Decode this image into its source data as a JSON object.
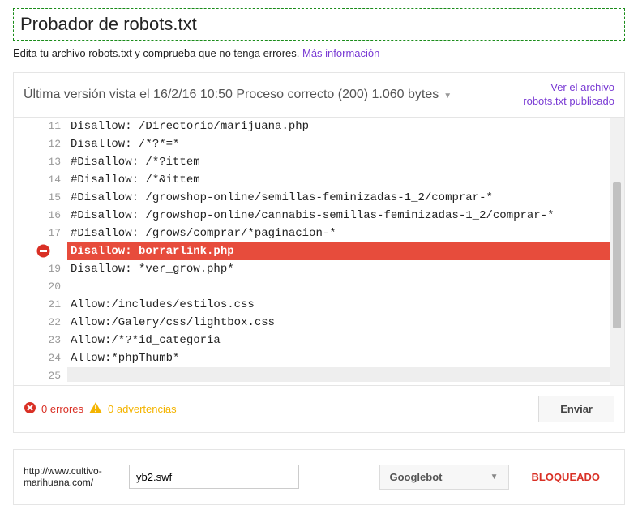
{
  "title": "Probador de robots.txt",
  "subtitle_text": "Edita tu archivo robots.txt y comprueba que no tenga errores. ",
  "subtitle_link": "Más información",
  "version_info": "Última versión vista el 16/2/16 10:50 Proceso correcto (200) 1.060 bytes",
  "view_link_line1": "Ver el archivo",
  "view_link_line2": "robots.txt publicado",
  "code_lines": [
    {
      "n": 11,
      "text": "Disallow: /Directorio/marijuana.php",
      "err": false
    },
    {
      "n": 12,
      "text": "Disallow: /*?*=*",
      "err": false
    },
    {
      "n": 13,
      "text": "#Disallow: /*?ittem",
      "err": false
    },
    {
      "n": 14,
      "text": "#Disallow: /*&ittem",
      "err": false
    },
    {
      "n": 15,
      "text": "#Disallow: /growshop-online/semillas-feminizadas-1_2/comprar-*",
      "err": false
    },
    {
      "n": 16,
      "text": "#Disallow: /growshop-online/cannabis-semillas-feminizadas-1_2/comprar-*",
      "err": false
    },
    {
      "n": 17,
      "text": "#Disallow: /grows/comprar/*paginacion-*",
      "err": false
    },
    {
      "n": 18,
      "text": "Disallow: borrarlink.php",
      "err": true
    },
    {
      "n": 19,
      "text": "Disallow: *ver_grow.php*",
      "err": false
    },
    {
      "n": 20,
      "text": "",
      "err": false
    },
    {
      "n": 21,
      "text": "Allow:/includes/estilos.css",
      "err": false
    },
    {
      "n": 22,
      "text": "Allow:/Galery/css/lightbox.css",
      "err": false
    },
    {
      "n": 23,
      "text": "Allow:/*?*id_categoria",
      "err": false
    },
    {
      "n": 24,
      "text": "Allow:*phpThumb*",
      "err": false
    },
    {
      "n": 25,
      "text": "",
      "err": false,
      "last": true
    }
  ],
  "errors_label": "0 errores",
  "warnings_label": "0 advertencias",
  "submit_label": "Enviar",
  "test": {
    "url_prefix": "http://www.cultivo-marihuana.com/",
    "url_value": "yb2.swf",
    "bot_label": "Googlebot",
    "result": "BLOQUEADO"
  }
}
